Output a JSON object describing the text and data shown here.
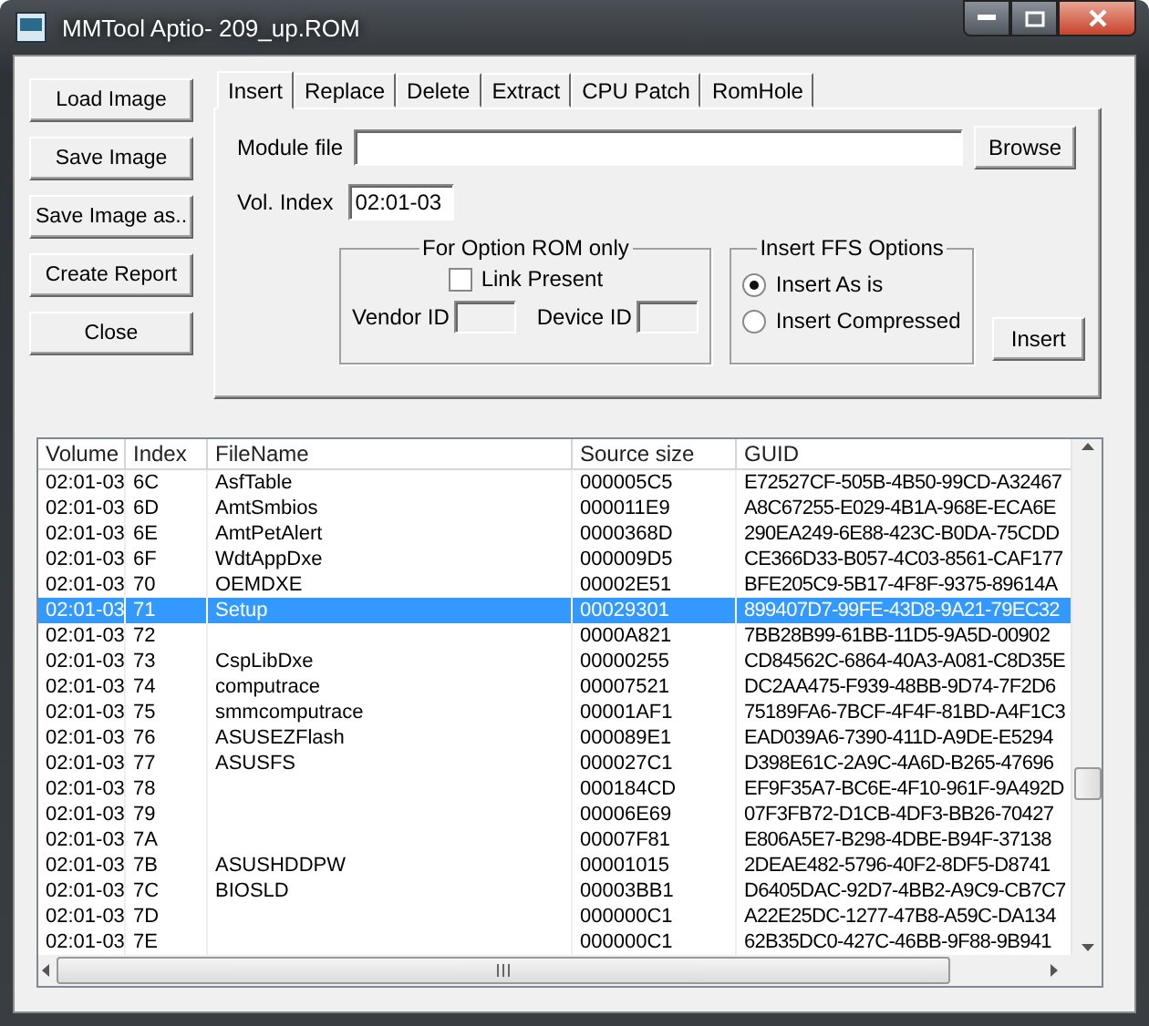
{
  "window": {
    "title": "MMTool Aptio- 209_up.ROM"
  },
  "side_buttons": [
    "Load Image",
    "Save Image",
    "Save Image as..",
    "Create Report",
    "Close"
  ],
  "tabs": [
    {
      "label": "Insert",
      "selected": true
    },
    {
      "label": "Replace",
      "selected": false
    },
    {
      "label": "Delete",
      "selected": false
    },
    {
      "label": "Extract",
      "selected": false
    },
    {
      "label": "CPU Patch",
      "selected": false
    },
    {
      "label": "RomHole",
      "selected": false
    }
  ],
  "module_file": {
    "label": "Module file",
    "browse": "Browse"
  },
  "vol_index": {
    "label": "Vol. Index",
    "value": "02:01-03"
  },
  "option_rom": {
    "title": "For Option ROM only",
    "link_present": {
      "label": "Link Present",
      "checked": false
    },
    "vendor_id": {
      "label": "Vendor ID"
    },
    "device_id": {
      "label": "Device ID"
    }
  },
  "ffs_options": {
    "title": "Insert FFS Options",
    "options": [
      {
        "label": "Insert As is",
        "selected": true
      },
      {
        "label": "Insert Compressed",
        "selected": false
      }
    ]
  },
  "insert_button": "Insert",
  "table": {
    "columns": [
      "Volume",
      "Index",
      "FileName",
      "Source size",
      "GUID"
    ],
    "rows": [
      {
        "cells": [
          "02:01-03",
          "6C",
          "AsfTable",
          "000005C5",
          "E72527CF-505B-4B50-99CD-A32467"
        ],
        "selected": false
      },
      {
        "cells": [
          "02:01-03",
          "6D",
          "AmtSmbios",
          "000011E9",
          "A8C67255-E029-4B1A-968E-ECA6E"
        ],
        "selected": false
      },
      {
        "cells": [
          "02:01-03",
          "6E",
          "AmtPetAlert",
          "0000368D",
          "290EA249-6E88-423C-B0DA-75CDD"
        ],
        "selected": false
      },
      {
        "cells": [
          "02:01-03",
          "6F",
          "WdtAppDxe",
          "000009D5",
          "CE366D33-B057-4C03-8561-CAF177"
        ],
        "selected": false
      },
      {
        "cells": [
          "02:01-03",
          "70",
          "OEMDXE",
          "00002E51",
          "BFE205C9-5B17-4F8F-9375-89614A"
        ],
        "selected": false
      },
      {
        "cells": [
          "02:01-03",
          "71",
          "Setup",
          "00029301",
          "899407D7-99FE-43D8-9A21-79EC32"
        ],
        "selected": true
      },
      {
        "cells": [
          "02:01-03",
          "72",
          "",
          "0000A821",
          "7BB28B99-61BB-11D5-9A5D-00902"
        ],
        "selected": false
      },
      {
        "cells": [
          "02:01-03",
          "73",
          "CspLibDxe",
          "00000255",
          "CD84562C-6864-40A3-A081-C8D35E"
        ],
        "selected": false
      },
      {
        "cells": [
          "02:01-03",
          "74",
          "computrace",
          "00007521",
          "DC2AA475-F939-48BB-9D74-7F2D6"
        ],
        "selected": false
      },
      {
        "cells": [
          "02:01-03",
          "75",
          "smmcomputrace",
          "00001AF1",
          "75189FA6-7BCF-4F4F-81BD-A4F1C3"
        ],
        "selected": false
      },
      {
        "cells": [
          "02:01-03",
          "76",
          "ASUSEZFlash",
          "000089E1",
          "EAD039A6-7390-411D-A9DE-E5294"
        ],
        "selected": false
      },
      {
        "cells": [
          "02:01-03",
          "77",
          "ASUSFS",
          "000027C1",
          "D398E61C-2A9C-4A6D-B265-47696"
        ],
        "selected": false
      },
      {
        "cells": [
          "02:01-03",
          "78",
          "",
          "000184CD",
          "EF9F35A7-BC6E-4F10-961F-9A492D"
        ],
        "selected": false
      },
      {
        "cells": [
          "02:01-03",
          "79",
          "",
          "00006E69",
          "07F3FB72-D1CB-4DF3-BB26-70427"
        ],
        "selected": false
      },
      {
        "cells": [
          "02:01-03",
          "7A",
          "",
          "00007F81",
          "E806A5E7-B298-4DBE-B94F-37138"
        ],
        "selected": false
      },
      {
        "cells": [
          "02:01-03",
          "7B",
          "ASUSHDDPW",
          "00001015",
          "2DEAE482-5796-40F2-8DF5-D8741"
        ],
        "selected": false
      },
      {
        "cells": [
          "02:01-03",
          "7C",
          "BIOSLD",
          "00003BB1",
          "D6405DAC-92D7-4BB2-A9C9-CB7C7"
        ],
        "selected": false
      },
      {
        "cells": [
          "02:01-03",
          "7D",
          "",
          "000000C1",
          "A22E25DC-1277-47B8-A59C-DA134"
        ],
        "selected": false
      },
      {
        "cells": [
          "02:01-03",
          "7E",
          "",
          "000000C1",
          "62B35DC0-427C-46BB-9F88-9B941"
        ],
        "selected": false
      }
    ]
  }
}
